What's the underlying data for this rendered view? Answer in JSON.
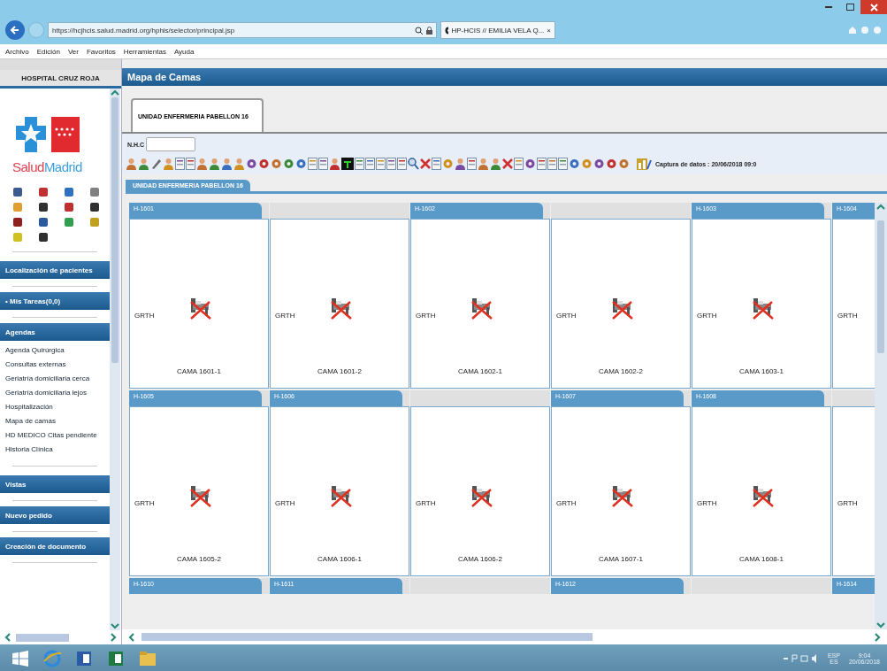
{
  "browser": {
    "url": "https://hcjhcis.salud.madrid.org/hphis/selector/principal.jsp",
    "tab": "HP-HCIS // EMILIA VELA Q...",
    "tab_close": "×",
    "menu": [
      "Archivo",
      "Edición",
      "Ver",
      "Favoritos",
      "Herramientas",
      "Ayuda"
    ]
  },
  "sidebar": {
    "title": "HOSPITAL CRUZ ROJA",
    "logo": {
      "first": "Salud",
      "second": "Madrid"
    },
    "sections": [
      {
        "kind": "bar",
        "label": "Localización de pacientes"
      },
      {
        "kind": "bar",
        "label": "• Mis Tareas(0,0)"
      },
      {
        "kind": "group",
        "label": "Agendas",
        "items": [
          "Agenda Quirúrgica",
          "Consultas externas",
          "Geriatría domiciliaria cerca",
          "Geriatría domiciliaria lejos",
          "Hospitalización",
          "Mapa de camas",
          "HD MEDICO Citas pendiente",
          "Historia Clínica"
        ]
      },
      {
        "kind": "bar",
        "label": "Vistas"
      },
      {
        "kind": "bar",
        "label": "Nuevo pedido"
      },
      {
        "kind": "bar",
        "label": "Creación de documento"
      }
    ]
  },
  "main": {
    "title": "Mapa de Camas",
    "tabs": [
      {
        "label": "UNIDAD ENFERMERIA PABELLON 16",
        "selected": true
      }
    ],
    "nhc_label": "N.H.C",
    "capture": "Captura de datos : 20/06/2018 09:0",
    "unit_tab": "UNIDAD ENFERMERIA PABELLON 16",
    "rows": [
      {
        "cells": [
          {
            "room": "H-1601",
            "bed": {
              "tag": "GRTH",
              "label": "CAMA 1601-1"
            }
          },
          {
            "bed": {
              "tag": "GRTH",
              "label": "CAMA 1601-2"
            }
          },
          {
            "room": "H-1602",
            "bed": {
              "tag": "GRTH",
              "label": "CAMA 1602-1"
            }
          },
          {
            "bed": {
              "tag": "GRTH",
              "label": "CAMA 1602-2"
            }
          },
          {
            "room": "H-1603",
            "bed": {
              "tag": "GRTH",
              "label": "CAMA 1603-1"
            }
          },
          {
            "room": "H-1604",
            "bed": {
              "tag": "GRTH"
            }
          }
        ]
      },
      {
        "cells": [
          {
            "room": "H-1605",
            "bed": {
              "tag": "GRTH",
              "label": "CAMA 1605-2"
            }
          },
          {
            "room": "H-1606",
            "bed": {
              "tag": "GRTH",
              "label": "CAMA 1606-1"
            }
          },
          {
            "bed": {
              "tag": "GRTH",
              "label": "CAMA 1606-2"
            }
          },
          {
            "room": "H-1607",
            "bed": {
              "tag": "GRTH",
              "label": "CAMA 1607-1"
            }
          },
          {
            "room": "H-1608",
            "bed": {
              "tag": "GRTH",
              "label": "CAMA 1608-1"
            }
          },
          {
            "bed": {
              "tag": "GRTH"
            }
          }
        ]
      },
      {
        "cells": [
          {
            "room": "H-1610"
          },
          {
            "room": "H-1611"
          },
          {},
          {
            "room": "H-1612"
          },
          {},
          {
            "room": "H-1614"
          }
        ]
      }
    ]
  },
  "taskbar": {
    "language": "ESP",
    "layout": "ES",
    "time": "9:04",
    "date": "20/06/2018"
  }
}
